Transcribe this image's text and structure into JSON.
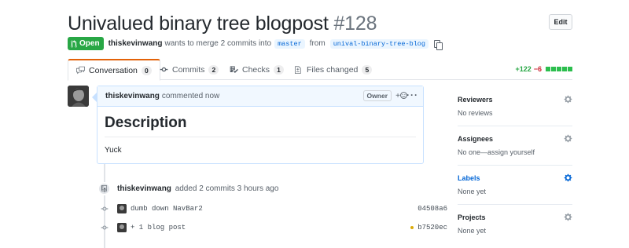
{
  "pr": {
    "title": "Univalued binary tree blogpost",
    "number": "#128",
    "edit_label": "Edit",
    "state_label": "Open",
    "author": "thiskevinwang",
    "merge_text": "wants to merge 2 commits into",
    "base_branch": "master",
    "from_text": "from",
    "head_branch": "unival-binary-tree-blog"
  },
  "tabs": [
    {
      "label": "Conversation",
      "count": "0",
      "icon": "comment-discussion-icon"
    },
    {
      "label": "Commits",
      "count": "2",
      "icon": "git-commit-icon"
    },
    {
      "label": "Checks",
      "count": "1",
      "icon": "checklist-icon"
    },
    {
      "label": "Files changed",
      "count": "5",
      "icon": "file-diff-icon"
    }
  ],
  "diffstat": {
    "additions": "+122",
    "deletions": "−6",
    "blocks_added": 5,
    "blocks_neutral": 0
  },
  "comment": {
    "author": "thiskevinwang",
    "action": "commented now",
    "badge": "Owner",
    "reaction_label": "+",
    "heading": "Description",
    "body": "Yuck"
  },
  "timeline": {
    "author": "thiskevinwang",
    "event": "added 2 commits 3 hours ago",
    "commits": [
      {
        "message": "dumb down NavBar2",
        "sha": "04508a6",
        "status": ""
      },
      {
        "message": "+ 1 blog post",
        "sha": "b7520ec",
        "status": "pending"
      }
    ]
  },
  "sidebar": {
    "sections": [
      {
        "title": "Reviewers",
        "value": "No reviews",
        "highlight": false
      },
      {
        "title": "Assignees",
        "value": "No one—assign yourself",
        "highlight": false
      },
      {
        "title": "Labels",
        "value": "None yet",
        "highlight": true
      },
      {
        "title": "Projects",
        "value": "None yet",
        "highlight": false
      }
    ]
  },
  "colors": {
    "open_green": "#28a745",
    "link_blue": "#0366d6",
    "active_tab_orange": "#e36209"
  }
}
